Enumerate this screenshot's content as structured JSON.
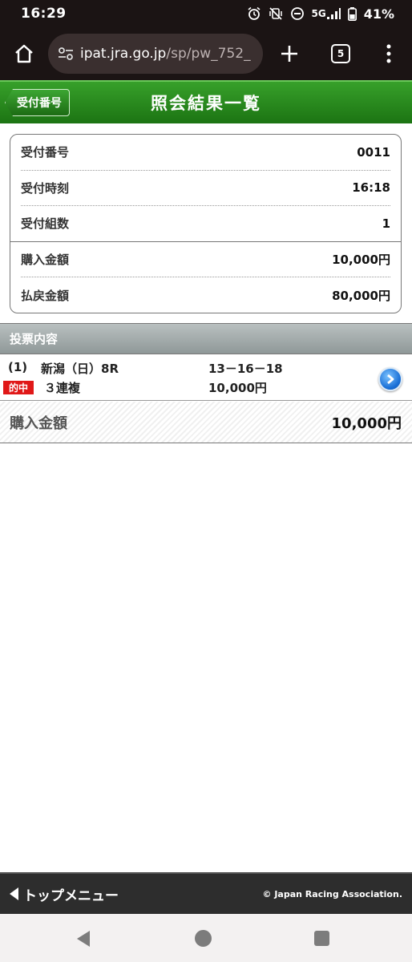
{
  "status_bar": {
    "time": "16:29",
    "network": "5G",
    "battery": "41%"
  },
  "browser": {
    "url_host": "ipat.jra.go.jp",
    "url_path": "/sp/pw_752_",
    "tab_count": "5"
  },
  "header": {
    "back_label": "受付番号",
    "title": "照会結果一覧"
  },
  "summary": {
    "rows": [
      {
        "label": "受付番号",
        "value": "0011"
      },
      {
        "label": "受付時刻",
        "value": "16:18"
      },
      {
        "label": "受付組数",
        "value": "1"
      },
      {
        "label": "購入金額",
        "value": "10,000円"
      },
      {
        "label": "払戻金額",
        "value": "80,000円"
      }
    ]
  },
  "votes": {
    "section_title": "投票内容",
    "items": [
      {
        "number": "(1)",
        "race": "新潟（日）8R",
        "combination": "13－16－18",
        "hit_badge": "的中",
        "bet_type": "３連複",
        "amount": "10,000円"
      }
    ],
    "total_label": "購入金額",
    "total_value": "10,000円"
  },
  "footer": {
    "top_menu": "トップメニュー",
    "copyright": "© Japan Racing Association."
  },
  "colors": {
    "header_green": "#2b8a1f",
    "hit_red": "#e01818",
    "detail_blue": "#1a6fd6"
  }
}
